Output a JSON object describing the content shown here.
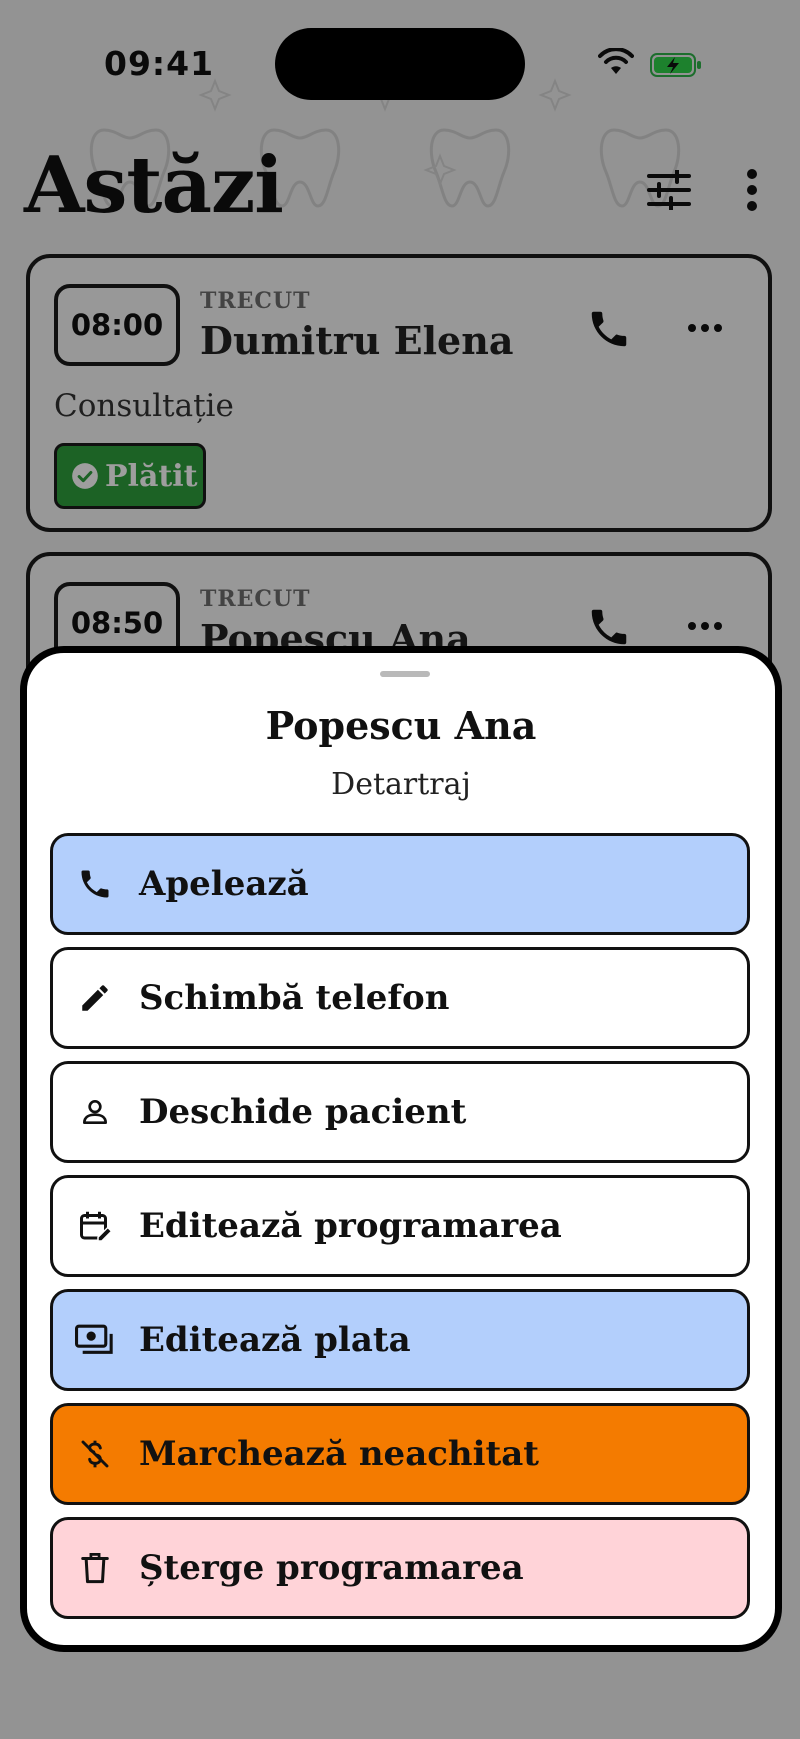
{
  "status_bar": {
    "time": "09:41"
  },
  "header": {
    "title": "Astăzi"
  },
  "appointments": [
    {
      "time": "08:00",
      "status": "TRECUT",
      "patient": "Dumitru Elena",
      "service": "Consultație",
      "payment": "Plătit"
    },
    {
      "time": "08:50",
      "status": "TRECUT",
      "patient": "Popescu Ana"
    }
  ],
  "sheet": {
    "title": "Popescu Ana",
    "subtitle": "Detartraj",
    "actions": [
      {
        "label": "Apelează",
        "icon": "phone-icon",
        "color": "#b3cffc"
      },
      {
        "label": "Schimbă telefon",
        "icon": "pencil-icon",
        "color": "#ffffff"
      },
      {
        "label": "Deschide pacient",
        "icon": "person-icon",
        "color": "#ffffff"
      },
      {
        "label": "Editează programarea",
        "icon": "calendar-edit-icon",
        "color": "#ffffff"
      },
      {
        "label": "Editează plata",
        "icon": "payments-icon",
        "color": "#b3cffc"
      },
      {
        "label": "Marchează neachitat",
        "icon": "money-off-icon",
        "color": "#f47b00"
      },
      {
        "label": "Șterge programarea",
        "icon": "trash-icon",
        "color": "#ffd3d8"
      }
    ]
  },
  "colors": {
    "paid_green": "#2e9e3d",
    "accent_blue": "#b3cffc",
    "warning_orange": "#f47b00",
    "danger_pink": "#ffd3d8"
  }
}
